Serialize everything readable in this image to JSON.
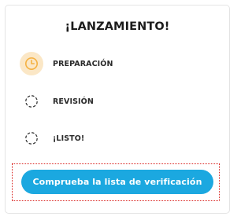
{
  "card": {
    "title": "¡LANZAMIENTO!"
  },
  "steps": [
    {
      "label": "PREPARACIÓN",
      "icon": "clock-icon",
      "state": "active"
    },
    {
      "label": "REVISIÓN",
      "icon": "dashed-circle-icon",
      "state": "pending"
    },
    {
      "label": "¡LISTO!",
      "icon": "dashed-circle-icon",
      "state": "pending"
    }
  ],
  "cta": {
    "label": "Comprueba la lista de verificación"
  },
  "colors": {
    "accent": "#1ba8e0",
    "active_icon_bg": "#fbe7c6",
    "active_icon": "#f5b142",
    "highlight_border": "#d9231f"
  }
}
